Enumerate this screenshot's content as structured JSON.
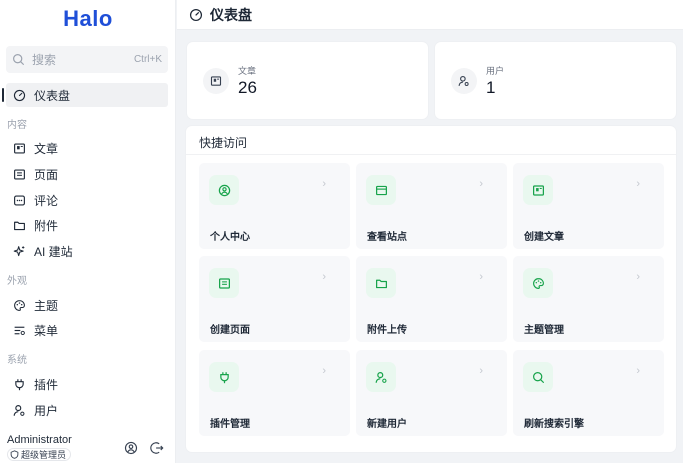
{
  "app": {
    "logo": "Halo"
  },
  "search": {
    "placeholder": "搜索",
    "shortcut": "Ctrl+K"
  },
  "sidebar": {
    "dashboard": "仪表盘",
    "groups": {
      "content": "内容",
      "appearance": "外观",
      "system": "系统"
    },
    "items": {
      "posts": "文章",
      "pages": "页面",
      "comments": "评论",
      "attachments": "附件",
      "ai_site": "AI 建站",
      "themes": "主题",
      "menus": "菜单",
      "plugins": "插件",
      "users": "用户"
    }
  },
  "user": {
    "name": "Administrator",
    "role": "超级管理员"
  },
  "header": {
    "title": "仪表盘"
  },
  "stats": [
    {
      "label": "文章",
      "value": "26",
      "icon": "post-icon"
    },
    {
      "label": "用户",
      "value": "1",
      "icon": "user-icon"
    }
  ],
  "quick_access": {
    "title": "快捷访问",
    "tiles": [
      {
        "label": "个人中心",
        "icon": "user-circle-icon"
      },
      {
        "label": "查看站点",
        "icon": "browser-icon"
      },
      {
        "label": "创建文章",
        "icon": "post-icon"
      },
      {
        "label": "创建页面",
        "icon": "page-icon"
      },
      {
        "label": "附件上传",
        "icon": "folder-icon"
      },
      {
        "label": "主题管理",
        "icon": "palette-icon"
      },
      {
        "label": "插件管理",
        "icon": "plug-icon"
      },
      {
        "label": "新建用户",
        "icon": "user-add-icon"
      },
      {
        "label": "刷新搜索引擎",
        "icon": "search-refresh-icon"
      }
    ]
  },
  "colors": {
    "brand": "#1f4fd8",
    "tile_icon_bg": "#e9f8ef",
    "tile_icon": "#16a34a"
  }
}
